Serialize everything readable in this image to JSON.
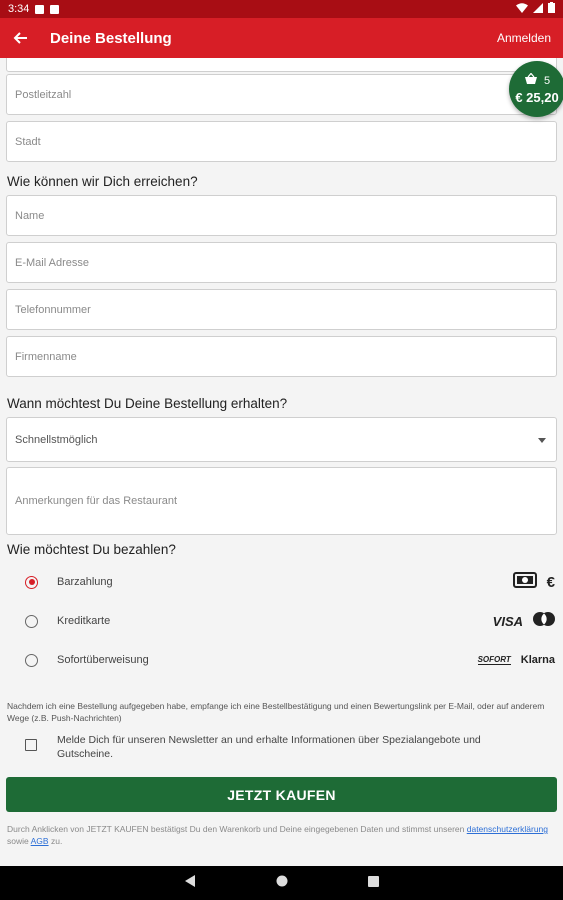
{
  "status_bar": {
    "time": "3:34"
  },
  "app_bar": {
    "title": "Deine Bestellung",
    "login_label": "Anmelden"
  },
  "cart": {
    "count": "5",
    "total": "€ 25,20"
  },
  "address": {
    "zip_placeholder": "Postleitzahl",
    "city_placeholder": "Stadt"
  },
  "contact": {
    "heading": "Wie können wir Dich erreichen?",
    "name_placeholder": "Name",
    "email_placeholder": "E-Mail Adresse",
    "phone_placeholder": "Telefonnummer",
    "company_placeholder": "Firmenname"
  },
  "delivery": {
    "heading": "Wann möchtest Du Deine Bestellung erhalten?",
    "time_value": "Schnellstmöglich",
    "remarks_placeholder": "Anmerkungen für das Restaurant"
  },
  "payment": {
    "heading": "Wie möchtest Du bezahlen?",
    "options": [
      {
        "label": "Barzahlung",
        "selected": true,
        "logos": [
          "cash-icon",
          "€"
        ]
      },
      {
        "label": "Kreditkarte",
        "selected": false,
        "logos": [
          "VISA",
          "mastercard-icon"
        ]
      },
      {
        "label": "Sofortüberweisung",
        "selected": false,
        "logos": [
          "SOFORT",
          "Klarna"
        ]
      }
    ]
  },
  "consent_note": "Nachdem ich eine Bestellung aufgegeben habe, empfange ich eine Bestellbestätigung und einen Bewertungslink per E-Mail, oder auf anderem Wege (z.B. Push-Nachrichten)",
  "newsletter_label": "Melde Dich für unseren Newsletter an und erhalte Informationen über Spezialangebote und Gutscheine.",
  "buy_button": "JETZT KAUFEN",
  "legal": {
    "text_before": "Durch Anklicken von JETZT KAUFEN bestätigst Du den Warenkorb und Deine eingegebenen Daten und stimmst unseren",
    "privacy_link": "datenschutzerklärung",
    "middle": "sowie",
    "terms_link": "AGB",
    "after": "zu."
  },
  "colors": {
    "primary": "#d71e26",
    "status_bar": "#a80d14",
    "accent_green": "#1e6b36",
    "link": "#2d6fd6"
  }
}
